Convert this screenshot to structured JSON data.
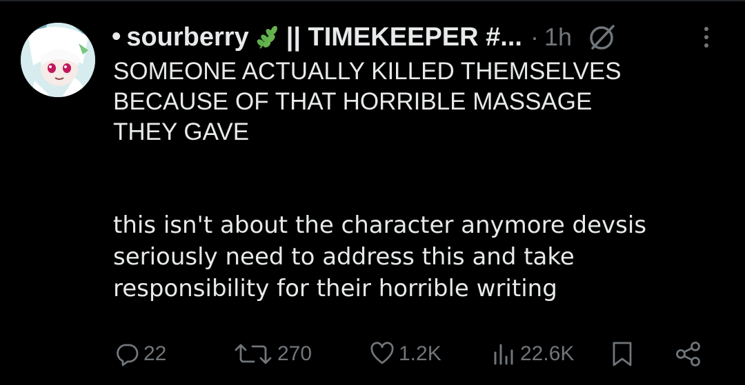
{
  "post": {
    "author": {
      "bullet": "•",
      "name": "sourberry",
      "name_suffix": "|| TIMEKEEPER #...",
      "emoji": "herb-icon"
    },
    "separator": "·",
    "timestamp": "1h",
    "text_caps": "SOMEONE ACTUALLY KILLED THEMSELVES\nBECAUSE OF THAT HORRIBLE MASSAGE\nTHEY GAVE",
    "text_body": "this isn't about the character anymore devsis\nseriously need to address this and take\nresponsibility for their horrible writing"
  },
  "actions": {
    "reply_count": "22",
    "repost_count": "270",
    "like_count": "1.2K",
    "views_count": "22.6K"
  },
  "icons": {
    "avatar": "avatar-image",
    "grok": "grok-icon",
    "more": "more-options-icon",
    "reply": "reply-icon",
    "repost": "repost-icon",
    "like": "heart-icon",
    "views": "views-chart-icon",
    "bookmark": "bookmark-icon",
    "share": "share-icon"
  },
  "colors": {
    "background": "#000000",
    "text": "#e7e9ea",
    "muted": "#71767b",
    "leaf_green": "#5fae4c"
  }
}
